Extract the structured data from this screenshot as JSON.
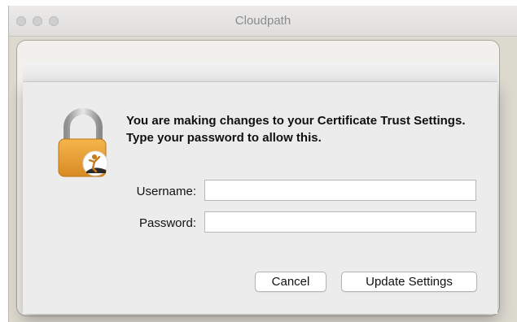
{
  "window": {
    "title": "Cloudpath"
  },
  "dialog": {
    "message": "You are making changes to your Certificate Trust Settings. Type your password to allow this.",
    "username": {
      "label": "Username:",
      "value": "",
      "placeholder": ""
    },
    "password": {
      "label": "Password:",
      "value": "",
      "placeholder": ""
    },
    "buttons": {
      "cancel": "Cancel",
      "confirm": "Update Settings"
    }
  },
  "icons": {
    "lock": "padlock-icon",
    "badge": "certificate-badge-icon"
  },
  "colors": {
    "lock_gold": "#e9a13b",
    "sheet_bg": "#ececec",
    "window_bg": "#dcd9cf"
  }
}
